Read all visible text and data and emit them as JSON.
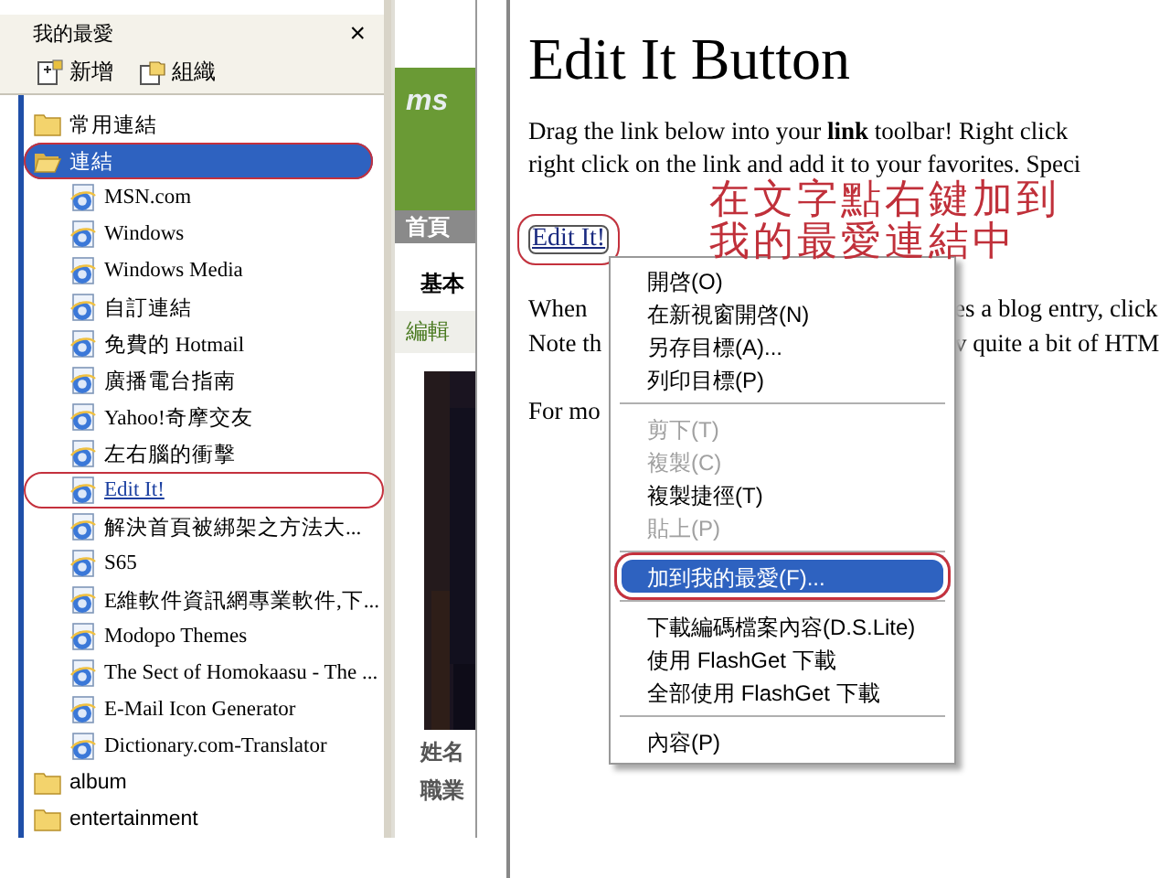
{
  "favorites_pane": {
    "title": "我的最愛",
    "close": "×",
    "toolbar": [
      {
        "label": "新增",
        "kind": "add"
      },
      {
        "label": "組織",
        "kind": "organize"
      }
    ],
    "tree": [
      {
        "label": "常用連結",
        "kind": "folder",
        "expanded": false,
        "selected": false,
        "circled": false
      },
      {
        "label": "連結",
        "kind": "folder",
        "expanded": true,
        "selected": true,
        "circled": true,
        "children": [
          {
            "label": "MSN.com",
            "kind": "link",
            "selected": false,
            "hovered": false,
            "circled": false
          },
          {
            "label": "Windows",
            "kind": "link",
            "selected": false,
            "hovered": false,
            "circled": false
          },
          {
            "label": "Windows Media",
            "kind": "link",
            "selected": false,
            "hovered": false,
            "circled": false
          },
          {
            "label": "自訂連結",
            "kind": "link",
            "selected": false,
            "hovered": false,
            "circled": false
          },
          {
            "label": "免費的 Hotmail",
            "kind": "link",
            "selected": false,
            "hovered": false,
            "circled": false
          },
          {
            "label": "廣播電台指南",
            "kind": "link",
            "selected": false,
            "hovered": false,
            "circled": false
          },
          {
            "label": "Yahoo!奇摩交友",
            "kind": "link",
            "selected": false,
            "hovered": false,
            "circled": false
          },
          {
            "label": "左右腦的衝擊",
            "kind": "link",
            "selected": false,
            "hovered": false,
            "circled": false
          },
          {
            "label": "Edit It!",
            "kind": "link",
            "selected": false,
            "hovered": true,
            "circled": true
          },
          {
            "label": "解決首頁被綁架之方法大...",
            "kind": "link",
            "selected": false,
            "hovered": false,
            "circled": false
          },
          {
            "label": "S65",
            "kind": "link",
            "selected": false,
            "hovered": false,
            "circled": false
          },
          {
            "label": "E維軟件資訊網專業軟件,下...",
            "kind": "link",
            "selected": false,
            "hovered": false,
            "circled": false
          },
          {
            "label": "Modopo Themes",
            "kind": "link",
            "selected": false,
            "hovered": false,
            "circled": false
          },
          {
            "label": "The Sect of Homokaasu - The ...",
            "kind": "link",
            "selected": false,
            "hovered": false,
            "circled": false
          },
          {
            "label": "E-Mail Icon Generator",
            "kind": "link",
            "selected": false,
            "hovered": false,
            "circled": false
          },
          {
            "label": "Dictionary.com-Translator",
            "kind": "link",
            "selected": false,
            "hovered": false,
            "circled": false
          }
        ]
      },
      {
        "label": "album",
        "kind": "folder",
        "expanded": false,
        "selected": false,
        "circled": false
      },
      {
        "label": "entertainment",
        "kind": "folder",
        "expanded": false,
        "selected": false,
        "circled": false
      }
    ]
  },
  "side_page": {
    "logo": "ms",
    "tab": "首頁",
    "heading": "基本",
    "button": "編輯",
    "labels": [
      "姓名",
      "職業"
    ]
  },
  "page": {
    "title": "Edit It Button",
    "lines": [
      "Drag the link below into your **link** toolbar! Right click",
      "right click on the link and add it to your favorites. Speci"
    ],
    "link": {
      "label": "Edit It!",
      "circled": true,
      "focused": true
    },
    "covered_lines": [
      {
        "left": "When",
        "right": "es a blog entry, click"
      },
      {
        "left": "Note th",
        "right": "v quite a bit of HTM"
      },
      {
        "left": "For mo"
      }
    ]
  },
  "context_menu": {
    "items": [
      {
        "kind": "item",
        "label": "開啓(O)",
        "disabled": false,
        "selected": false,
        "circled": false
      },
      {
        "kind": "item",
        "label": "在新視窗開啓(N)",
        "disabled": false,
        "selected": false,
        "circled": false
      },
      {
        "kind": "item",
        "label": "另存目標(A)...",
        "disabled": false,
        "selected": false,
        "circled": false
      },
      {
        "kind": "item",
        "label": "列印目標(P)",
        "disabled": false,
        "selected": false,
        "circled": false
      },
      {
        "kind": "separator"
      },
      {
        "kind": "item",
        "label": "剪下(T)",
        "disabled": true,
        "selected": false,
        "circled": false
      },
      {
        "kind": "item",
        "label": "複製(C)",
        "disabled": true,
        "selected": false,
        "circled": false
      },
      {
        "kind": "item",
        "label": "複製捷徑(T)",
        "disabled": false,
        "selected": false,
        "circled": false
      },
      {
        "kind": "item",
        "label": "貼上(P)",
        "disabled": true,
        "selected": false,
        "circled": false
      },
      {
        "kind": "separator"
      },
      {
        "kind": "item",
        "label": "加到我的最愛(F)...",
        "disabled": false,
        "selected": true,
        "circled": true
      },
      {
        "kind": "separator"
      },
      {
        "kind": "item",
        "label": "下載編碼檔案內容(D.S.Lite)",
        "disabled": false,
        "selected": false,
        "circled": false
      },
      {
        "kind": "item",
        "label": "使用 FlashGet 下載",
        "disabled": false,
        "selected": false,
        "circled": false
      },
      {
        "kind": "item",
        "label": "全部使用 FlashGet 下載",
        "disabled": false,
        "selected": false,
        "circled": false
      },
      {
        "kind": "separator"
      },
      {
        "kind": "item",
        "label": "內容(P)",
        "disabled": false,
        "selected": false,
        "circled": false
      }
    ]
  },
  "annotation": {
    "text": "在文字點右鍵加到我的最愛連結中"
  }
}
